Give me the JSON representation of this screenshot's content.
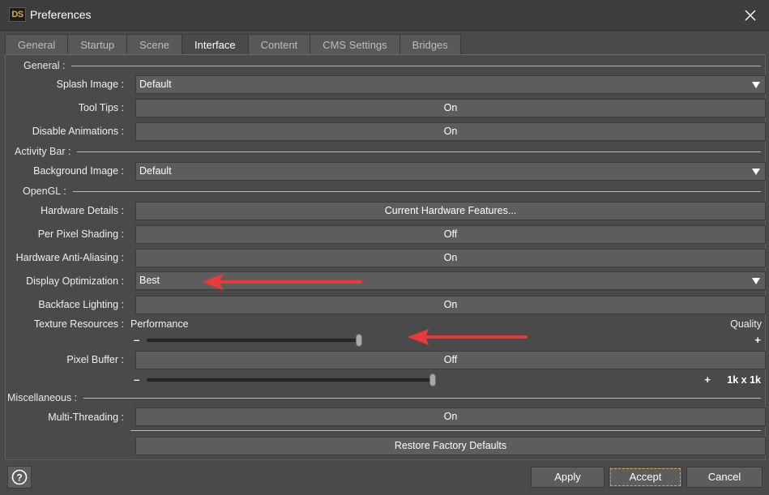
{
  "window": {
    "title": "Preferences",
    "logo": "DS"
  },
  "tabs": [
    {
      "label": "General"
    },
    {
      "label": "Startup"
    },
    {
      "label": "Scene"
    },
    {
      "label": "Interface",
      "active": true
    },
    {
      "label": "Content"
    },
    {
      "label": "CMS Settings"
    },
    {
      "label": "Bridges"
    }
  ],
  "sections": {
    "general": "General :",
    "activity_bar": "Activity Bar :",
    "opengl": "OpenGL :",
    "misc": "Miscellaneous :"
  },
  "general": {
    "splash_image": {
      "label": "Splash Image :",
      "value": "Default"
    },
    "tool_tips": {
      "label": "Tool Tips :",
      "value": "On"
    },
    "disable_animations": {
      "label": "Disable Animations :",
      "value": "On"
    }
  },
  "activity_bar": {
    "background_image": {
      "label": "Background Image :",
      "value": "Default"
    }
  },
  "opengl": {
    "hardware_details": {
      "label": "Hardware Details :",
      "value": "Current Hardware Features..."
    },
    "per_pixel_shading": {
      "label": "Per Pixel Shading :",
      "value": "Off"
    },
    "hardware_aa": {
      "label": "Hardware Anti-Aliasing :",
      "value": "On"
    },
    "display_optimization": {
      "label": "Display Optimization :",
      "value": "Best"
    },
    "backface_lighting": {
      "label": "Backface Lighting :",
      "value": "On"
    },
    "texture_resources": {
      "label": "Texture Resources :",
      "min_label": "Performance",
      "max_label": "Quality",
      "position": 0.34
    },
    "pixel_buffer": {
      "label": "Pixel Buffer :",
      "value": "Off",
      "size_label": "1k x 1k",
      "position": 0.51
    }
  },
  "misc": {
    "multi_threading": {
      "label": "Multi-Threading :",
      "value": "On"
    }
  },
  "restore_label": "Restore Factory Defaults",
  "buttons": {
    "apply": "Apply",
    "accept": "Accept",
    "cancel": "Cancel"
  },
  "colors": {
    "accent": "#d4a24a",
    "annotation_arrow": "#e83a3a",
    "background": "#4a4a4a"
  }
}
